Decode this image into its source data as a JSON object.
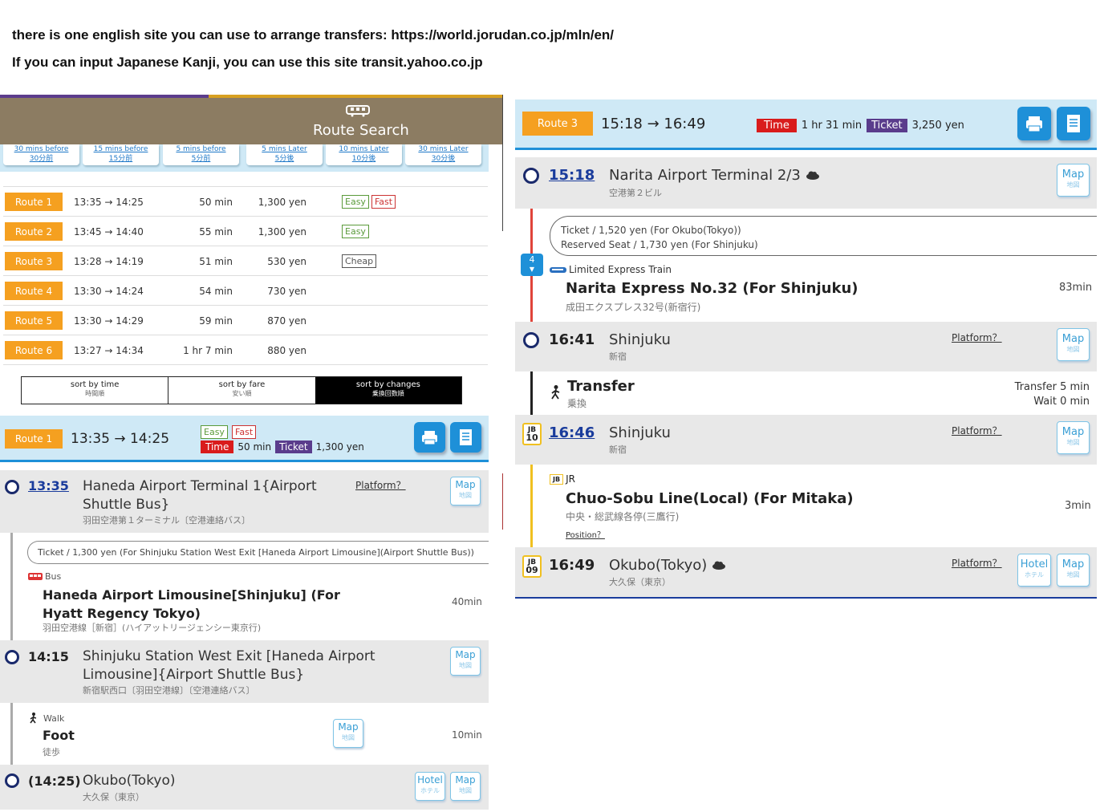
{
  "intro": {
    "line1": "there is one english site you can use to arrange transfers: https://world.jorudan.co.jp/mln/en/",
    "line2": "If you can input Japanese Kanji, you can use this site transit.yahoo.co.jp"
  },
  "header": {
    "title": "Route Search"
  },
  "timebtns": [
    {
      "en": "30 mins before",
      "jp": "30分前"
    },
    {
      "en": "15 mins before",
      "jp": "15分前"
    },
    {
      "en": "5 mins before",
      "jp": "5分前"
    },
    {
      "en": "5 mins Later",
      "jp": "5分後"
    },
    {
      "en": "10 mins Later",
      "jp": "10分後"
    },
    {
      "en": "30 mins Later",
      "jp": "30分後"
    }
  ],
  "routes": [
    {
      "label": "Route 1",
      "time": "13:35 → 14:25",
      "dur": "50 min",
      "fare": "1,300 yen",
      "tags": [
        "Easy",
        "Fast"
      ]
    },
    {
      "label": "Route 2",
      "time": "13:45 → 14:40",
      "dur": "55 min",
      "fare": "1,300 yen",
      "tags": [
        "Easy"
      ]
    },
    {
      "label": "Route 3",
      "time": "13:28 → 14:19",
      "dur": "51 min",
      "fare": "530 yen",
      "tags": [
        "Cheap"
      ]
    },
    {
      "label": "Route 4",
      "time": "13:30 → 14:24",
      "dur": "54 min",
      "fare": "730 yen",
      "tags": []
    },
    {
      "label": "Route 5",
      "time": "13:30 → 14:29",
      "dur": "59 min",
      "fare": "870 yen",
      "tags": []
    },
    {
      "label": "Route 6",
      "time": "13:27 → 14:34",
      "dur": "1 hr 7 min",
      "fare": "880 yen",
      "tags": []
    }
  ],
  "sort": [
    {
      "en": "sort by time",
      "jp": "時間順"
    },
    {
      "en": "sort by fare",
      "jp": "安い順"
    },
    {
      "en": "sort by changes",
      "jp": "乗換回数順"
    }
  ],
  "left": {
    "route_label": "Route 1",
    "time": "13:35 → 14:25",
    "tag1": "Easy",
    "tag2": "Fast",
    "time_label": "Time",
    "dur": "50 min",
    "ticket_label": "Ticket",
    "fare": "1,300 yen",
    "s1": {
      "time": "13:35",
      "name1": "Haneda Airport Terminal 1{Airport",
      "name2": "Shuttle Bus}",
      "jp": "羽田空港第１ターミナル〔空港連絡バス〕",
      "platform": "Platform？"
    },
    "ticket": "Ticket / 1,300 yen (For Shinjuku Station West Exit [Haneda Airport Limousine](Airport Shuttle Bus))",
    "bus": {
      "type": "Bus",
      "name1": "Haneda Airport Limousine[Shinjuku] (For",
      "name2": "Hyatt Regency Tokyo)",
      "jp": "羽田空港線［新宿］(ハイアットリージェンシー東京行)",
      "dur": "40min"
    },
    "s2": {
      "time": "14:15",
      "name1": "Shinjuku Station West Exit [Haneda Airport",
      "name2": "Limousine]{Airport Shuttle Bus}",
      "jp": "新宿駅西口〔羽田空港線〕〔空港連絡バス〕"
    },
    "walk": {
      "type": "Walk",
      "name": "Foot",
      "jp": "徒歩",
      "dur": "10min"
    },
    "s3": {
      "time": "(14:25)",
      "name": "Okubo(Tokyo)",
      "jp": "大久保（東京）"
    }
  },
  "right": {
    "route_label": "Route 3",
    "time": "15:18 → 16:49",
    "time_label": "Time",
    "dur": "1 hr 31 min",
    "ticket_label": "Ticket",
    "fare": "3,250 yen",
    "s1": {
      "time": "15:18",
      "name": "Narita Airport Terminal 2/3",
      "jp": "空港第２ビル"
    },
    "ticket1": "Ticket / 1,520 yen (For Okubo(Tokyo))",
    "ticket2": "Reserved Seat / 1,730 yen (For Shinjuku)",
    "train": {
      "car": "4",
      "type": "Limited Express Train",
      "name": "Narita Express No.32 (For Shinjuku)",
      "jp": "成田エクスプレス32号(新宿行)",
      "dur": "83min"
    },
    "s2": {
      "time": "16:41",
      "name": "Shinjuku",
      "jp": "新宿",
      "platform": "Platform？"
    },
    "transfer": {
      "title": "Transfer",
      "jp": "乗換",
      "t1": "Transfer 5 min",
      "t2": "Wait 0 min"
    },
    "s3": {
      "code_a": "JB",
      "code_b": "10",
      "time": "16:46",
      "name": "Shinjuku",
      "jp": "新宿",
      "platform": "Platform？"
    },
    "jr": {
      "code": "JB",
      "type": "JR",
      "name": "Chuo-Sobu Line(Local) (For Mitaka)",
      "jp": "中央・総武線各停(三鷹行)",
      "pos": "Position？",
      "dur": "3min"
    },
    "s4": {
      "code_a": "JB",
      "code_b": "09",
      "time": "16:49",
      "name": "Okubo(Tokyo)",
      "jp": "大久保（東京）",
      "platform": "Platform？"
    }
  },
  "buttons": {
    "map": "Map",
    "map_jp": "地図",
    "hotel": "Hotel",
    "hotel_jp": "ホテル"
  }
}
